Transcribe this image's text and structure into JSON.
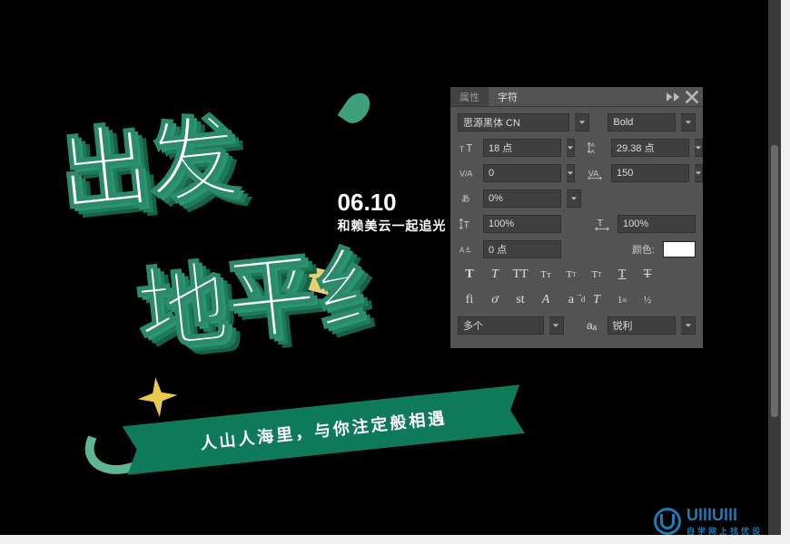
{
  "artwork": {
    "line1": "出发",
    "line2": "地平纟",
    "date": "06.10",
    "tagline": "和赖美云一起追光",
    "ribbon": "人山人海里，与你注定般相遇"
  },
  "panel": {
    "tabs": {
      "properties": "属性",
      "character": "字符"
    },
    "font_family": "思源黑体 CN",
    "font_style": "Bold",
    "font_size": "18 点",
    "leading": "29.38 点",
    "kerning": "0",
    "tracking": "150",
    "tsume": "0%",
    "scale_v": "100%",
    "scale_h": "100%",
    "baseline": "0 点",
    "color_label": "颜色:",
    "language": "多个",
    "antialias": "锐利",
    "opentype_aa_label": "aₐ"
  },
  "watermark": {
    "brand": "UlllUlll",
    "sub": "自学网上找优设"
  }
}
